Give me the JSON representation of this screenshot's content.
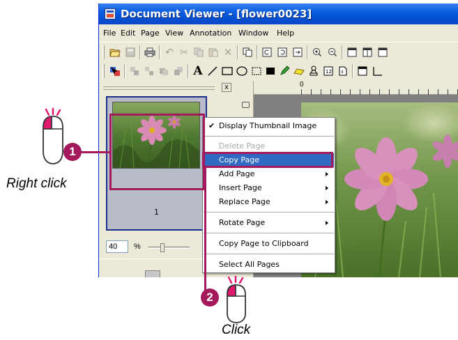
{
  "window": {
    "title": "Document Viewer - [flower0023]"
  },
  "menubar": {
    "items": [
      "File",
      "Edit",
      "Page",
      "View",
      "Annotation",
      "Window",
      "Help"
    ]
  },
  "toolbar1": {
    "buttons": [
      "open-icon",
      "save-icon",
      "print-icon",
      "undo-icon",
      "cut-icon",
      "copy-icon",
      "paste-icon",
      "delete-icon",
      "copy-page-icon",
      "rotate-left-icon",
      "rotate-right-icon",
      "rotate-icon",
      "zoom-in-icon",
      "zoom-out-icon",
      "layout-single-icon",
      "layout-double-icon",
      "layout-grid-icon"
    ]
  },
  "toolbar2": {
    "buttons": [
      "select-icon",
      "group-icon",
      "ungroup-icon",
      "front-icon",
      "back-icon",
      "text-icon",
      "line-icon",
      "rectangle-icon",
      "ellipse-icon",
      "dotted-rect-icon",
      "filled-rect-icon",
      "marker-icon",
      "highlighter-icon",
      "stamp-icon",
      "page-number-icon",
      "page-icon",
      "note-icon",
      "border-icon"
    ],
    "text_tool_label": "A"
  },
  "left_pane": {
    "close_label": "x",
    "page_number": "1",
    "zoom_value": "40",
    "zoom_unit": "%"
  },
  "ruler": {
    "origin_label": "0"
  },
  "context_menu": {
    "items": [
      {
        "label": "Display Thumbnail Image",
        "checked": true,
        "state": "normal"
      },
      {
        "label": "Delete Page",
        "state": "disabled"
      },
      {
        "label": "Copy Page",
        "state": "selected"
      },
      {
        "label": "Add Page",
        "state": "normal",
        "submenu": true
      },
      {
        "label": "Insert Page",
        "state": "normal",
        "submenu": true
      },
      {
        "label": "Replace Page",
        "state": "normal",
        "submenu": true
      },
      {
        "label": "Rotate Page",
        "state": "normal",
        "submenu": true
      },
      {
        "label": "Copy Page to Clipboard",
        "state": "normal"
      },
      {
        "label": "Select All Pages",
        "state": "normal"
      }
    ]
  },
  "callouts": {
    "step1_number": "1",
    "step1_label": "Right click",
    "step2_number": "2",
    "step2_label": "Click"
  },
  "colors": {
    "highlight": "#a3195b",
    "menu_selection": "#316ac5",
    "title_bar": "#0a5ee0"
  }
}
